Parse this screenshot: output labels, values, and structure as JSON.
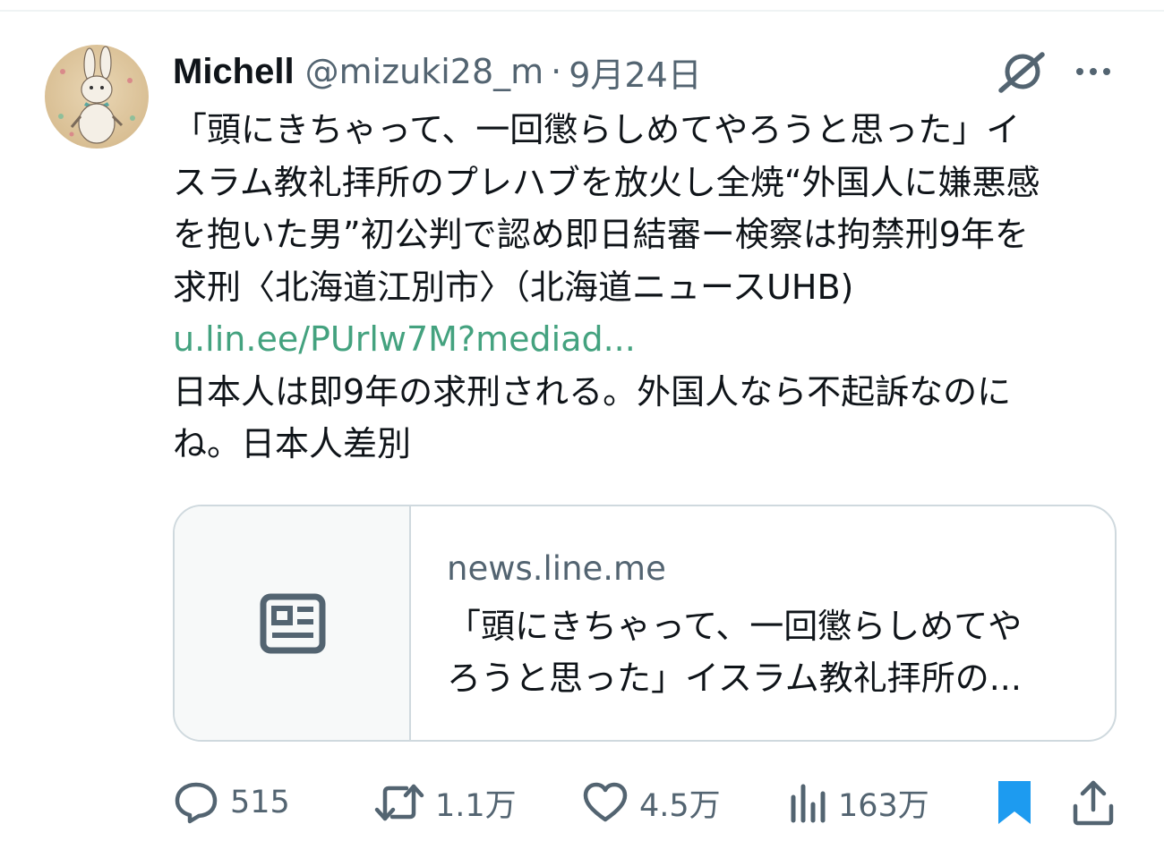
{
  "tweet": {
    "author_name": "Michell",
    "handle": "@mizuki28_m",
    "separator": "·",
    "date": "9月24日",
    "text_lines_before_link": [
      "「頭にきちゃって、一回懲らしめてやろうと思った」イ",
      "スラム教礼拝所のプレハブを放火し全焼“外国人に嫌悪感",
      "を抱いた男”初公判で認め即日結審ー検察は拘禁刑9年を",
      "求刑〈北海道江別市〉（北海道ニュースUHB)"
    ],
    "link": "u.lin.ee/PUrlw7M?mediad...",
    "text_lines_after_link": [
      "日本人は即9年の求刑される。外国人なら不起訴なのに",
      "ね。日本人差別"
    ]
  },
  "card": {
    "domain": "news.line.me",
    "title_lines": [
      "「頭にきちゃって、一回懲らしめてや",
      "ろうと思った」イスラム教礼拝所の..."
    ]
  },
  "actions": {
    "replies": "515",
    "reposts": "1.1万",
    "likes": "4.5万",
    "views": "163万"
  },
  "colors": {
    "text": "#0f1419",
    "secondary": "#536471",
    "link": "#44a27f",
    "bookmark_active": "#1d9bf0",
    "border": "#cfd9de"
  }
}
